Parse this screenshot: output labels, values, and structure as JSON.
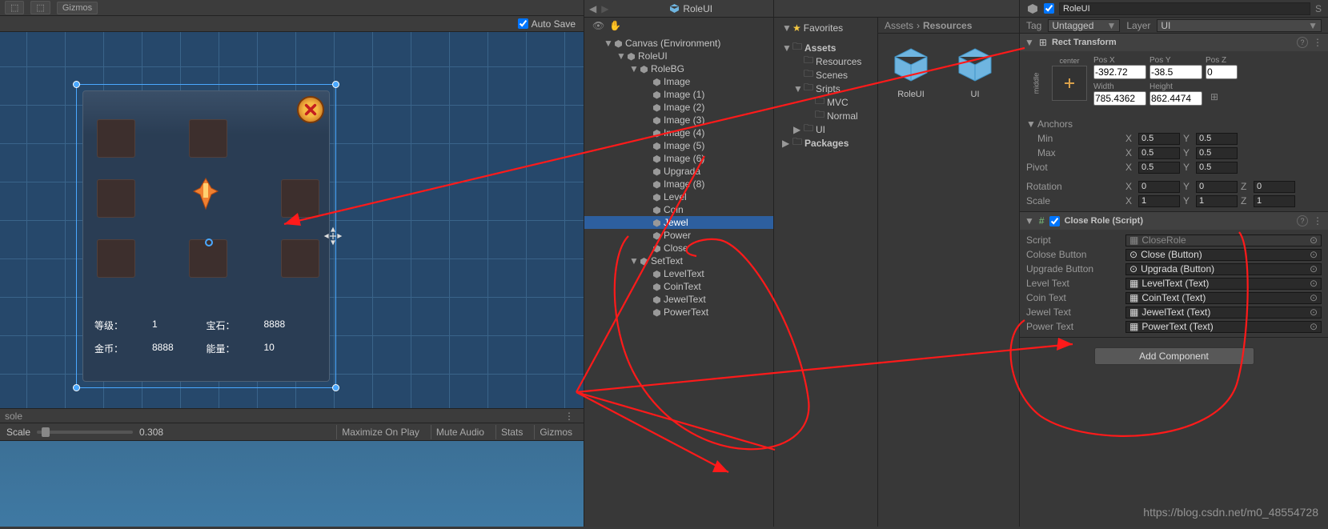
{
  "toolbar": {
    "auto_save_label": "Auto Save",
    "gizmos": "Gizmos"
  },
  "scene": {
    "stats": {
      "level_label": "等级：",
      "level_value": "1",
      "jewel_label": "宝石：",
      "jewel_value": "8888",
      "coin_label": "金币：",
      "coin_value": "8888",
      "power_label": "能量：",
      "power_value": "10"
    }
  },
  "console": {
    "tab": "sole"
  },
  "scale_bar": {
    "label": "Scale",
    "value": "0.308",
    "opts": [
      "Maximize On Play",
      "Mute Audio",
      "Stats",
      "Gizmos"
    ]
  },
  "hierarchy": {
    "title": "RoleUI",
    "nodes": {
      "canvas": "Canvas (Environment)",
      "roleui": "RoleUI",
      "rolebg": "RoleBG",
      "images": [
        "Image",
        "Image (1)",
        "Image (2)",
        "Image (3)",
        "Image (4)",
        "Image (5)",
        "Image (6)"
      ],
      "upgrada": "Upgrada",
      "image8": "Image (8)",
      "level": "Level",
      "coin": "Coin",
      "jewel": "Jewel",
      "power": "Power",
      "close": "Close",
      "settext": "SetText",
      "texts": [
        "LevelText",
        "CoinText",
        "JewelText",
        "PowerText"
      ]
    }
  },
  "project": {
    "favorites": "Favorites",
    "assets": "Assets",
    "folders": {
      "resources": "Resources",
      "scenes": "Scenes",
      "sripts": "Sripts",
      "mvc": "MVC",
      "normal": "Normal",
      "ui": "UI"
    },
    "packages": "Packages",
    "breadcrumb": [
      "Assets",
      "Resources"
    ],
    "items": [
      "RoleUI",
      "UI"
    ]
  },
  "inspector": {
    "name": "RoleUI",
    "tag_label": "Tag",
    "tag_value": "Untagged",
    "layer_label": "Layer",
    "layer_value": "UI",
    "rect_transform": {
      "title": "Rect Transform",
      "anchor_v": "center",
      "anchor_h": "middle",
      "headers": [
        "Pos X",
        "Pos Y",
        "Pos Z"
      ],
      "pos": [
        "-392.72",
        "-38.5",
        "0"
      ],
      "size_headers": [
        "Width",
        "Height"
      ],
      "size": [
        "785.4362",
        "862.4474"
      ],
      "anchors_label": "Anchors",
      "min_label": "Min",
      "min": [
        "0.5",
        "0.5"
      ],
      "max_label": "Max",
      "max": [
        "0.5",
        "0.5"
      ],
      "pivot_label": "Pivot",
      "pivot": [
        "0.5",
        "0.5"
      ],
      "rotation_label": "Rotation",
      "rotation": [
        "0",
        "0",
        "0"
      ],
      "scale_label": "Scale",
      "scale": [
        "1",
        "1",
        "1"
      ]
    },
    "script_comp": {
      "title": "Close Role (Script)",
      "script_label": "Script",
      "script_value": "CloseRole",
      "fields": [
        {
          "label": "Colose Button",
          "value": "Close (Button)"
        },
        {
          "label": "Upgrade Button",
          "value": "Upgrada (Button)"
        },
        {
          "label": "Level Text",
          "value": "LevelText (Text)"
        },
        {
          "label": "Coin Text",
          "value": "CoinText (Text)"
        },
        {
          "label": "Jewel Text",
          "value": "JewelText (Text)"
        },
        {
          "label": "Power Text",
          "value": "PowerText (Text)"
        }
      ]
    },
    "add_component": "Add Component"
  },
  "watermark": "https://blog.csdn.net/m0_48554728"
}
